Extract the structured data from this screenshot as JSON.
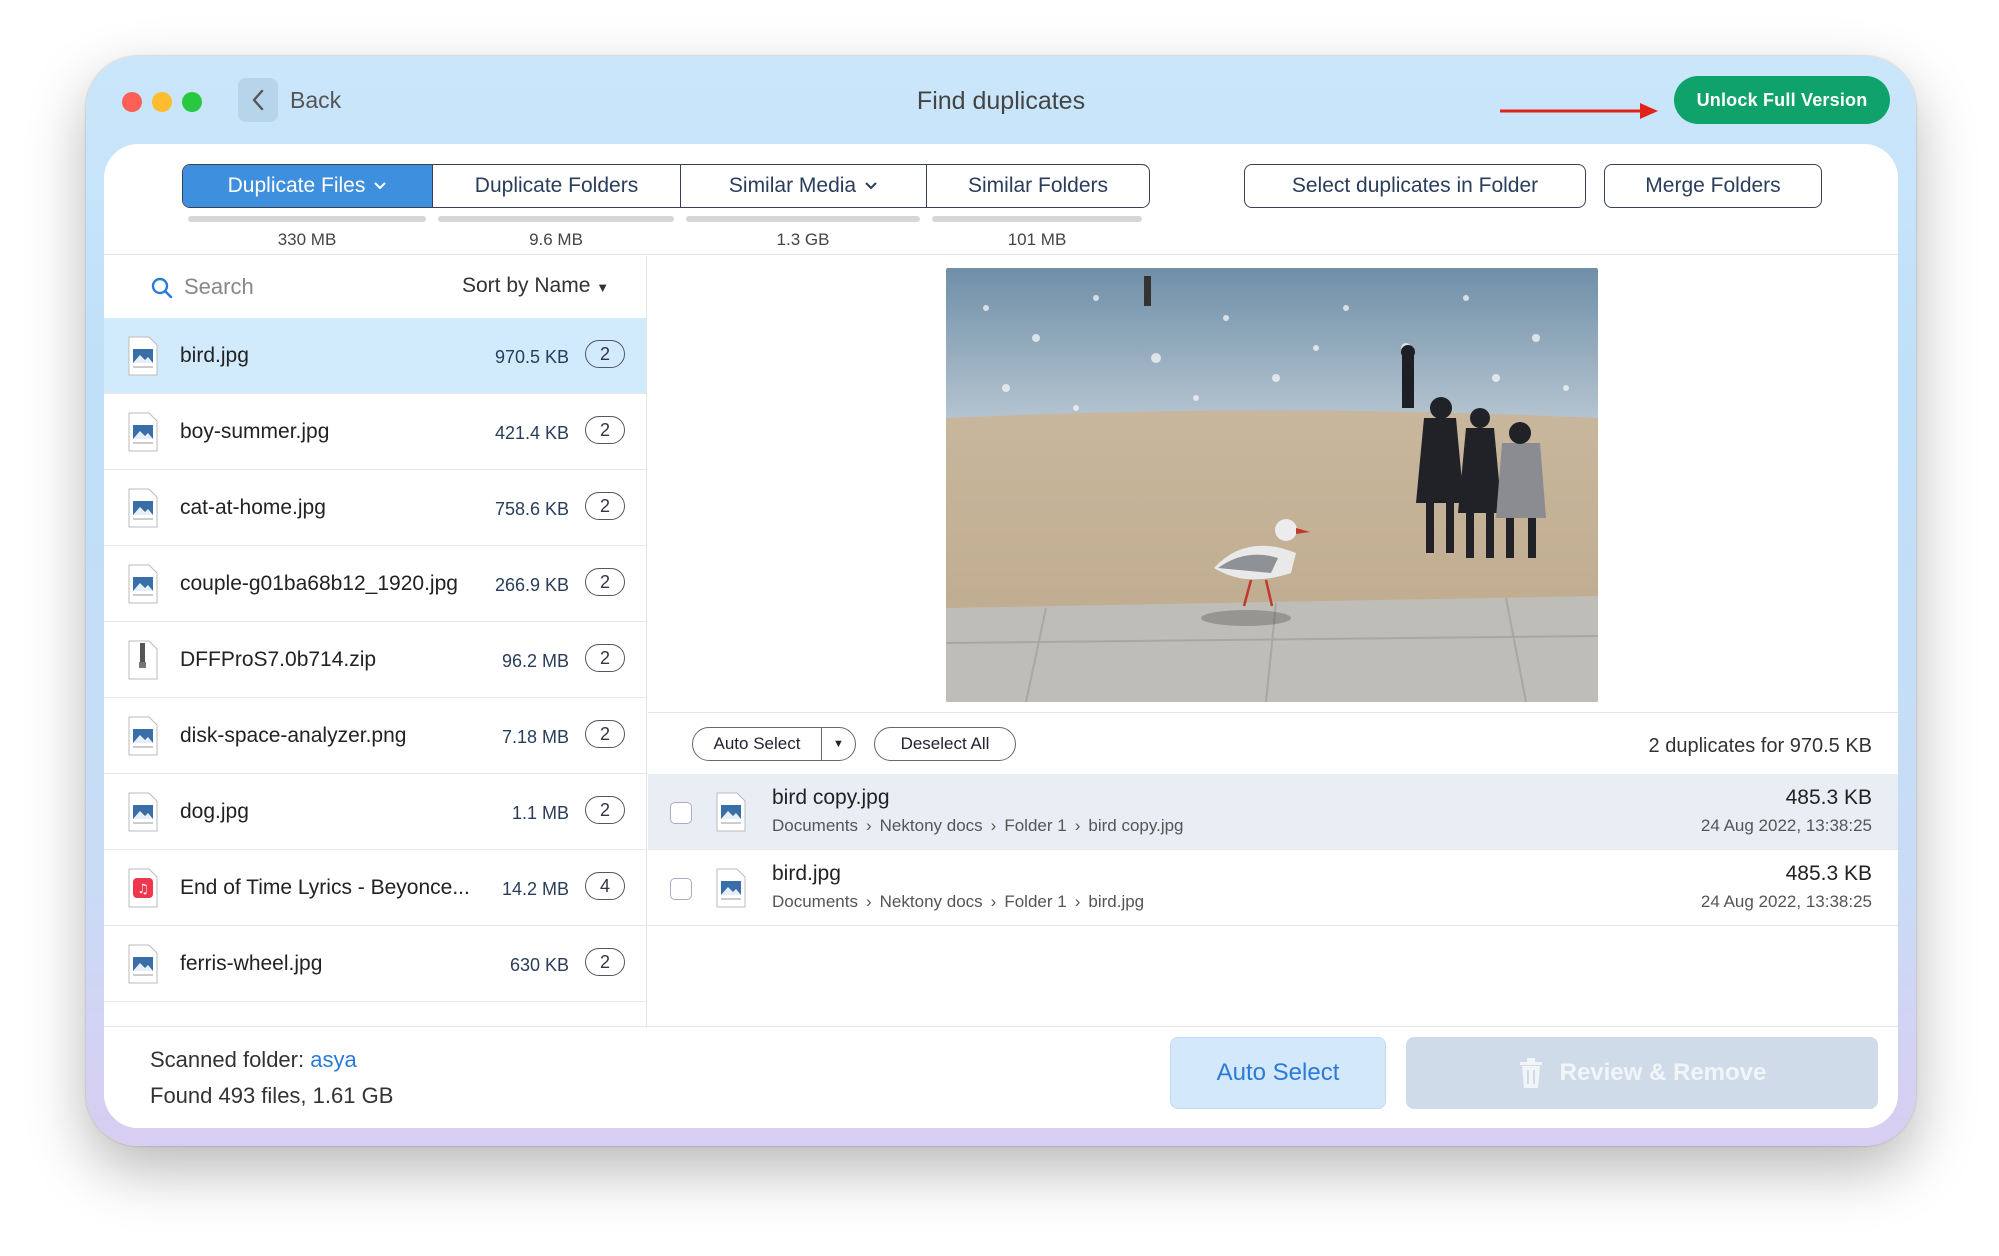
{
  "window": {
    "title": "Find duplicates",
    "back_label": "Back",
    "unlock_label": "Unlock Full Version",
    "accent": "#3f8fdf",
    "unlock_color": "#0fa36b"
  },
  "tabs": [
    {
      "label": "Duplicate Files",
      "size": "330 MB",
      "active": true,
      "chevron": true
    },
    {
      "label": "Duplicate Folders",
      "size": "9.6 MB",
      "active": false,
      "chevron": false
    },
    {
      "label": "Similar Media",
      "size": "1.3 GB",
      "active": false,
      "chevron": true
    },
    {
      "label": "Similar Folders",
      "size": "101 MB",
      "active": false,
      "chevron": false
    }
  ],
  "actions": {
    "select_in_folder": "Select duplicates in Folder",
    "merge_folders": "Merge Folders"
  },
  "search": {
    "placeholder": "Search",
    "sort_label": "Sort by Name"
  },
  "files": [
    {
      "name": "bird.jpg",
      "size": "970.5 KB",
      "count": "2",
      "type": "jpg",
      "selected": true
    },
    {
      "name": "boy-summer.jpg",
      "size": "421.4 KB",
      "count": "2",
      "type": "jpg"
    },
    {
      "name": "cat-at-home.jpg",
      "size": "758.6 KB",
      "count": "2",
      "type": "jpg"
    },
    {
      "name": "couple-g01ba68b12_1920.jpg",
      "size": "266.9 KB",
      "count": "2",
      "type": "jpg"
    },
    {
      "name": "DFFProS7.0b714.zip",
      "size": "96.2 MB",
      "count": "2",
      "type": "zip"
    },
    {
      "name": "disk-space-analyzer.png",
      "size": "7.18 MB",
      "count": "2",
      "type": "png"
    },
    {
      "name": "dog.jpg",
      "size": "1.1 MB",
      "count": "2",
      "type": "jpg"
    },
    {
      "name": "End of Time Lyrics - Beyonce...",
      "size": "14.2 MB",
      "count": "4",
      "type": "mp3"
    },
    {
      "name": "ferris-wheel.jpg",
      "size": "630 KB",
      "count": "2",
      "type": "jpg"
    }
  ],
  "duplicates_toolbar": {
    "auto_select": "Auto Select",
    "deselect_all": "Deselect All",
    "summary": "2 duplicates for 970.5 KB"
  },
  "duplicates": [
    {
      "name": "bird copy.jpg",
      "path": [
        "Documents",
        "Nektony docs",
        "Folder 1",
        "bird copy.jpg"
      ],
      "size": "485.3 KB",
      "date": "24 Aug 2022, 13:38:25",
      "selected": true
    },
    {
      "name": "bird.jpg",
      "path": [
        "Documents",
        "Nektony docs",
        "Folder 1",
        "bird.jpg"
      ],
      "size": "485.3 KB",
      "date": "24 Aug 2022, 13:38:25",
      "selected": false
    }
  ],
  "footer": {
    "scanned_label": "Scanned folder:",
    "scanned_folder": "asya",
    "found": "Found 493 files, 1.61 GB",
    "auto_select": "Auto Select",
    "review_remove": "Review & Remove"
  }
}
